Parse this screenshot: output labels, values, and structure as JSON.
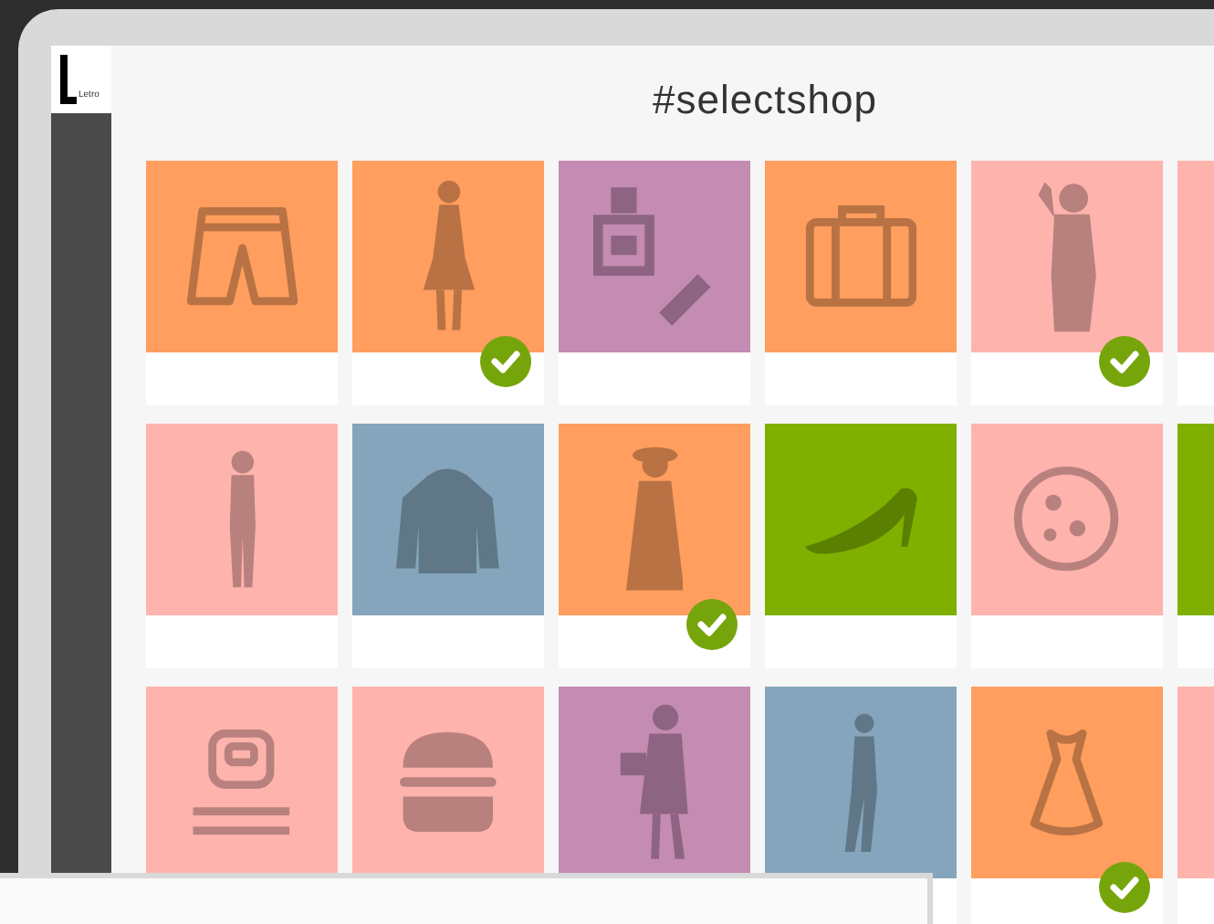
{
  "logo": {
    "text": "Letro"
  },
  "title": "#selectshop",
  "tiles": [
    {
      "kind": "shorts",
      "color": "#ff9e5e",
      "checked": false
    },
    {
      "kind": "woman",
      "color": "#ff9e5e",
      "checked": true
    },
    {
      "kind": "nail-polish",
      "color": "#c48bb3",
      "checked": false
    },
    {
      "kind": "suitcase",
      "color": "#ff9e5e",
      "checked": false
    },
    {
      "kind": "selfie",
      "color": "#ffb3ad",
      "checked": true
    },
    {
      "kind": "blank",
      "color": "#ffb3ad",
      "checked": false
    },
    {
      "kind": "man",
      "color": "#ffb3ad",
      "checked": false
    },
    {
      "kind": "jacket",
      "color": "#84a5bb",
      "checked": false
    },
    {
      "kind": "hat-woman",
      "color": "#ff9e5e",
      "checked": true
    },
    {
      "kind": "heel",
      "color": "#7fb000",
      "checked": false
    },
    {
      "kind": "pizza",
      "color": "#ffb3ad",
      "checked": false
    },
    {
      "kind": "blank",
      "color": "#7fb000",
      "checked": false
    },
    {
      "kind": "scale",
      "color": "#ffb3ad"
    },
    {
      "kind": "burger",
      "color": "#ffb3ad"
    },
    {
      "kind": "bag-woman",
      "color": "#c48bb3"
    },
    {
      "kind": "man-pose",
      "color": "#84a5bb",
      "checked": false
    },
    {
      "kind": "dress",
      "color": "#ff9e5e",
      "checked": true
    },
    {
      "kind": "blank",
      "color": "#ffb3ad",
      "checked": false
    }
  ]
}
